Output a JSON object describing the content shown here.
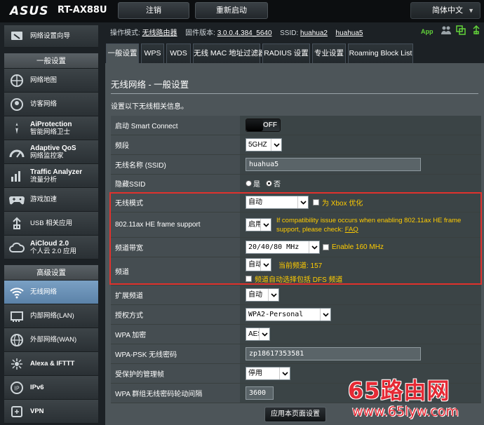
{
  "brand": "ASUS",
  "model": "RT-AX88U",
  "top": {
    "logout": "注销",
    "reboot": "重新启动",
    "language": "简体中文"
  },
  "status": {
    "mode_label": "操作模式:",
    "mode_value": "无线路由器",
    "fw_label": "固件版本:",
    "fw_value": "3.0.0.4.384_5640",
    "ssid_label": "SSID:",
    "ssid_1": "huahua2",
    "ssid_2": "huahua5",
    "app": "App"
  },
  "sidebar": {
    "top_item": "网络设置向导",
    "general_head": "一般设置",
    "general_items": [
      {
        "label": "网络地图"
      },
      {
        "label": "访客网络"
      },
      {
        "bold": "AiProtection",
        "label": "智能网络卫士"
      },
      {
        "bold": "Adaptive QoS",
        "label": "网络监控家"
      },
      {
        "bold": "Traffic Analyzer",
        "label": "流量分析"
      },
      {
        "label": "游戏加速"
      },
      {
        "label": "USB 相关应用"
      },
      {
        "bold": "AiCloud 2.0",
        "label": "个人云 2.0 应用"
      }
    ],
    "advanced_head": "高级设置",
    "advanced_items": [
      {
        "label": "无线网络"
      },
      {
        "label": "内部网络(LAN)"
      },
      {
        "label": "外部网络(WAN)"
      },
      {
        "label": "Alexa & IFTTT"
      },
      {
        "label": "IPv6"
      },
      {
        "label": "VPN"
      }
    ]
  },
  "tabs": [
    "一般设置",
    "WPS",
    "WDS",
    "无线 MAC 地址过滤器",
    "RADIUS 设置",
    "专业设置",
    "Roaming Block List"
  ],
  "panel": {
    "title": "无线网络 - 一般设置",
    "desc": "设置以下无线相关信息。",
    "apply": "应用本页面设置"
  },
  "rows": {
    "smart_connect": {
      "label": "启动 Smart Connect",
      "toggle": "OFF"
    },
    "band": {
      "label": "频段",
      "value": "5GHZ"
    },
    "ssid": {
      "label": "无线名称 (SSID)",
      "value": "huahua5"
    },
    "hide_ssid": {
      "label": "隐藏SSID",
      "yes": "是",
      "no": "否"
    },
    "wireless_mode": {
      "label": "无线模式",
      "value": "自动",
      "xbox": "为 Xbox 优化"
    },
    "he_frame": {
      "label": "802.11ax HE frame support",
      "value": "启用",
      "note": "If compatibility issue occurs when enabling 802.11ax HE frame support, please check:",
      "faq": "FAQ"
    },
    "bandwidth": {
      "label": "频道带宽",
      "value": "20/40/80 MHz",
      "enable160": "Enable 160 MHz"
    },
    "channel": {
      "label": "频道",
      "value": "自动",
      "current": "当前频道: 157",
      "dfs": "频道自动选择包括 DFS 频道"
    },
    "ext_channel": {
      "label": "扩展频道",
      "value": "自动"
    },
    "auth": {
      "label": "授权方式",
      "value": "WPA2-Personal"
    },
    "wpa_enc": {
      "label": "WPA 加密",
      "value": "AES"
    },
    "psk": {
      "label": "WPA-PSK 无线密码",
      "value": "zp18617353581"
    },
    "pmf": {
      "label": "受保护的管理帧",
      "value": "停用"
    },
    "rekey": {
      "label": "WPA 群组无线密码轮动间隔",
      "value": "3600"
    }
  },
  "watermark": {
    "big": "65路由网",
    "small": "www.65lyw.com"
  },
  "colors": {
    "highlight_border": "#e0322d",
    "yellow_text": "#ffcc00",
    "app_green": "#62d23a"
  }
}
